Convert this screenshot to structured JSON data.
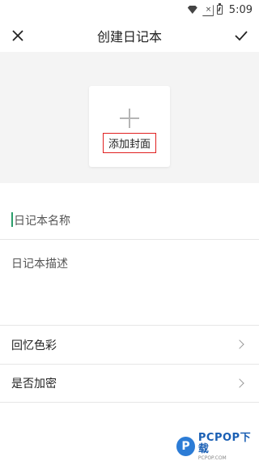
{
  "status_bar": {
    "time": "5:09",
    "icons": [
      "wifi-icon",
      "signal-icon",
      "battery-icon"
    ]
  },
  "header": {
    "title": "创建日记本",
    "close_icon": "close-icon",
    "confirm_icon": "check-icon"
  },
  "cover": {
    "add_label": "添加封面",
    "plus_icon": "plus-icon"
  },
  "form": {
    "name_placeholder": "日记本名称",
    "description_placeholder": "日记本描述"
  },
  "settings": [
    {
      "label": "回忆色彩"
    },
    {
      "label": "是否加密"
    }
  ],
  "watermark": {
    "brand": "PCPOP下载",
    "sub": "PCPOP.COM",
    "logo_letter": "P"
  },
  "colors": {
    "cover_bg": "#f4f4f4",
    "highlight_border": "#e02020",
    "cursor": "#2a9d6a",
    "divider": "#e6e6e6"
  }
}
